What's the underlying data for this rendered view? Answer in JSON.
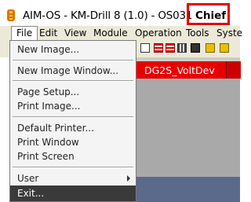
{
  "window": {
    "title": "AIM-OS - KM-Drill 8 (1.0) - OS031",
    "role": "Chief",
    "highlight_color": "#e30000"
  },
  "menubar": {
    "items": [
      "File",
      "Edit",
      "View",
      "Module",
      "Operation",
      "Tools",
      "Syste"
    ]
  },
  "tab": {
    "label": "DG2S_VoltDev",
    "color": "#e80000"
  },
  "file_menu": {
    "items": [
      "New Image...",
      "New Image Window...",
      "Page Setup...",
      "Print Image...",
      "Default Printer...",
      "Print Window",
      "Print Screen",
      "User",
      "Exit..."
    ],
    "highlighted": "Exit..."
  },
  "icons": {
    "app": "app-icon",
    "submenu": "chevron-right-icon"
  }
}
